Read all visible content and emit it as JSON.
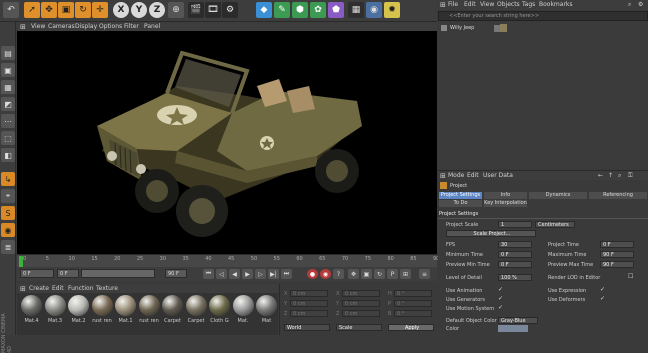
{
  "viewport_menu": [
    "View",
    "Cameras",
    "Display",
    "Options",
    "Filter",
    "Panel"
  ],
  "toolbar_axes": [
    "X",
    "Y",
    "Z"
  ],
  "object_manager": {
    "menu": [
      "File",
      "Edit",
      "View",
      "Objects",
      "Tags",
      "Bookmarks"
    ],
    "search_placeholder": "<<Enter your search string here>>",
    "object_name": "Willy Jeep"
  },
  "timeline": {
    "ticks": [
      "0",
      "5",
      "10",
      "15",
      "20",
      "25",
      "30",
      "35",
      "40",
      "45",
      "50",
      "55",
      "60",
      "65",
      "70",
      "75",
      "80",
      "85",
      "90"
    ],
    "start": "0 F",
    "current": "0 F",
    "end": "90 F",
    "end2": "90 F"
  },
  "material_manager": {
    "menu": [
      "Create",
      "Edit",
      "Function",
      "Texture"
    ],
    "materials": [
      {
        "label": "Mat.4",
        "color": "#6a6a66"
      },
      {
        "label": "Mat.3",
        "color": "#8a8a86"
      },
      {
        "label": "Mat.2",
        "color": "#b8b8b4"
      },
      {
        "label": "rust ren",
        "color": "#7a6a55"
      },
      {
        "label": "Mat.1",
        "color": "#9b8f7a"
      },
      {
        "label": "rust ren",
        "color": "#6e6552"
      },
      {
        "label": "Carpet",
        "color": "#5f5a50"
      },
      {
        "label": "Carpet",
        "color": "#77705f"
      },
      {
        "label": "Cloth G",
        "color": "#6d6a4a"
      },
      {
        "label": "Mat.",
        "color": "#9a9a9a"
      },
      {
        "label": "Mat",
        "color": "#7a7a7a"
      }
    ]
  },
  "coordinates": {
    "rows": [
      {
        "a": "X",
        "av": "0 cm",
        "b": "X",
        "bv": "0 cm",
        "c": "H",
        "cv": "0 °"
      },
      {
        "a": "Y",
        "av": "0 cm",
        "b": "Y",
        "bv": "0 cm",
        "c": "P",
        "cv": "0 °"
      },
      {
        "a": "Z",
        "av": "0 cm",
        "b": "Z",
        "bv": "0 cm",
        "c": "B",
        "cv": "0 °"
      }
    ],
    "world": "World",
    "scale": "Scale",
    "apply": "Apply"
  },
  "attributes": {
    "menu": [
      "Mode",
      "Edit",
      "User Data"
    ],
    "header": "Project",
    "tabs_row1": [
      "Project Settings",
      "Info",
      "Dynamics",
      "Referencing"
    ],
    "tabs_row2": [
      "To Do",
      "Key Interpolation"
    ],
    "section": "Project Settings",
    "project_scale_label": "Project Scale",
    "project_scale_value": "1",
    "project_scale_unit": "Centimeters",
    "scale_button": "Scale Project...",
    "fps_label": "FPS",
    "fps_value": "30",
    "project_time_label": "Project Time",
    "project_time_value": "0 F",
    "min_time_label": "Minimum Time",
    "min_time_value": "0 F",
    "max_time_label": "Maximum Time",
    "max_time_value": "90 F",
    "prev_min_label": "Preview Min Time",
    "prev_min_value": "0 F",
    "prev_max_label": "Preview Max Time",
    "prev_max_value": "90 F",
    "lod_label": "Level of Detail",
    "lod_value": "100 %",
    "render_lod_label": "Render LOD in Editor",
    "use_animation": "Use Animation",
    "use_expression": "Use Expression",
    "use_generators": "Use Generators",
    "use_deformers": "Use Deformers",
    "use_motion": "Use Motion System",
    "default_color_label": "Default Object Color",
    "default_color_value": "Gray-Blue",
    "color_label": "Color"
  },
  "side_label": "MAXON CINEMA 4D"
}
